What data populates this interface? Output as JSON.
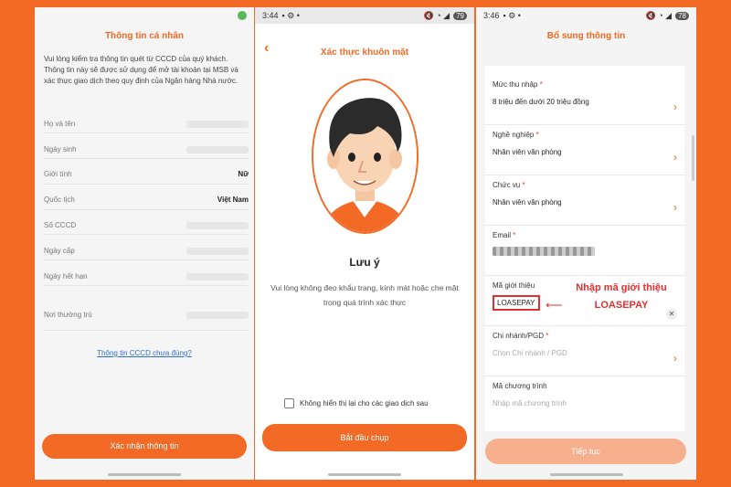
{
  "screen1": {
    "title": "Thông tin cá nhân",
    "intro": "Vui lòng kiểm tra thông tin quét từ CCCD của quý khách. Thông tin này sẽ được sử dụng để mở tài khoản tại MSB và xác thực  giao dịch theo quy định của Ngân hàng Nhà nước.",
    "fields": [
      {
        "label": "Họ và tên",
        "value": ""
      },
      {
        "label": "Ngày sinh",
        "value": ""
      },
      {
        "label": "Giới tính",
        "value": "Nữ"
      },
      {
        "label": "Quốc tịch",
        "value": "Việt Nam"
      },
      {
        "label": "Số CCCD",
        "value": ""
      },
      {
        "label": "Ngày cấp",
        "value": ""
      },
      {
        "label": "Ngày hết hạn",
        "value": ""
      },
      {
        "label": "Nơi thường trú",
        "value": ""
      }
    ],
    "link": "Thông tin CCCD chưa đúng?",
    "button": "Xác nhận thông tin"
  },
  "screen2": {
    "time": "3:44",
    "battery": "79",
    "title": "Xác thực khuôn mặt",
    "note_title": "Lưu ý",
    "note_text": "Vui lòng không đeo khẩu trang, kính mát hoặc che mặt trong quá trình xác thực",
    "checkbox_label": "Không hiển thị lại cho các giao dịch sau",
    "button": "Bắt đầu chụp"
  },
  "screen3": {
    "time": "3:46",
    "battery": "78",
    "title": "Bổ sung thông tin",
    "income": {
      "label": "Mức thu nhập",
      "value": "8 triệu đến dưới 20 triệu đồng"
    },
    "job": {
      "label": "Nghề nghiệp",
      "value": "Nhân viên văn phòng"
    },
    "position": {
      "label": "Chức vụ",
      "value": "Nhân viên văn phòng"
    },
    "email": {
      "label": "Email"
    },
    "referral": {
      "label": "Mã giới thiệu",
      "value": "LOASEPAY"
    },
    "branch": {
      "label": "Chi nhánh/PGD",
      "placeholder": "Chọn Chi nhánh / PGD"
    },
    "program": {
      "label": "Mã chương trình",
      "placeholder": "Nhập mã chương trình"
    },
    "button": "Tiếp tục"
  },
  "annotation": {
    "line1": "Nhập mã giới thiệu",
    "line2": "LOASEPAY"
  },
  "colors": {
    "accent": "#f26a25",
    "annotation": "#e03030"
  }
}
